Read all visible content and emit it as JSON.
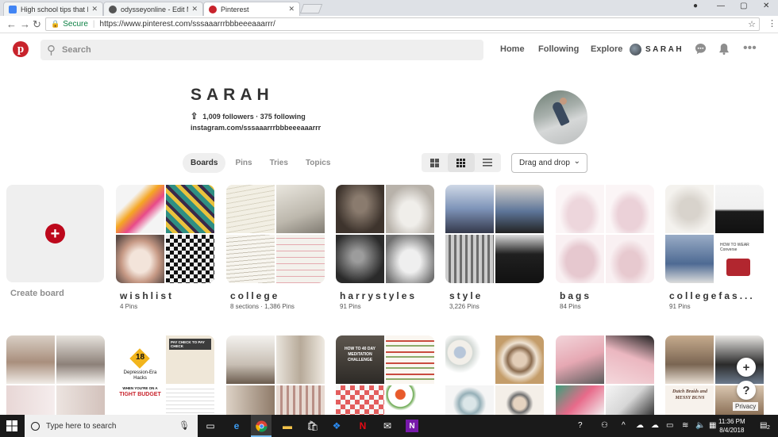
{
  "browser": {
    "tabs": [
      {
        "title": "High school tips that I w",
        "icon_color": "#4285f4",
        "active": false
      },
      {
        "title": "odysseyonline - Edit Mo",
        "icon_color": "#555555",
        "active": false
      },
      {
        "title": "Pinterest",
        "icon_color": "#c8232c",
        "active": true
      }
    ],
    "secure_label": "Secure",
    "url": "https://www.pinterest.com/sssaaarrrbbbeeeaaarrr/"
  },
  "header": {
    "search_placeholder": "Search",
    "nav": {
      "home": "Home",
      "following": "Following",
      "explore": "Explore"
    },
    "user_name": "SARAH"
  },
  "profile": {
    "name": "SARAH",
    "stats": "1,009 followers · 375 following",
    "link": "instagram.com/sssaaarrrbbbeeeaaarrr"
  },
  "tabs": [
    "Boards",
    "Pins",
    "Tries",
    "Topics"
  ],
  "sort_label": "Drag and drop",
  "create_board_label": "Create board",
  "boards": [
    {
      "name": "wishlist",
      "meta": "4 Pins"
    },
    {
      "name": "college",
      "meta": "8 sections · 1,386 Pins"
    },
    {
      "name": "harrystyles",
      "meta": "91 Pins"
    },
    {
      "name": "style",
      "meta": "3,226 Pins"
    },
    {
      "name": "bags",
      "meta": "84 Pins"
    },
    {
      "name": "collegefas...",
      "meta": "91 Pins"
    }
  ],
  "cover_text": {
    "budget_num": "18",
    "budget_line1": "Depression-Era",
    "budget_line2": "Hacks",
    "budget_line3": "WHEN YOU'RE ON A",
    "budget_line4": "TIGHT BUDGET",
    "paycheck": "PAY CHECK TO PAY CHECK",
    "challenge": "HOW TO 40 DAY MEDITATION CHALLENGE",
    "converse": "HOW TO WEAR Converse",
    "dutch": "Dutch Braids and MESSY BUNS"
  },
  "floating": {
    "privacy": "Privacy"
  },
  "taskbar": {
    "search_placeholder": "Type here to search",
    "time": "11:36 PM",
    "date": "8/4/2018",
    "notifications": "2"
  }
}
